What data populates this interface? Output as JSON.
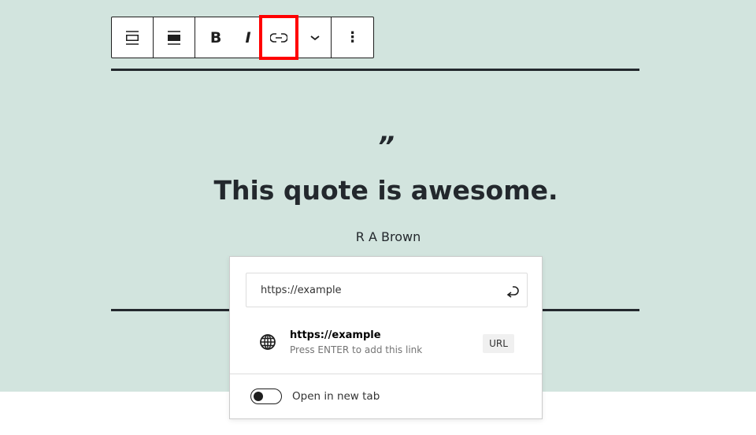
{
  "toolbar": {
    "buttons": [
      "block-type",
      "align",
      "bold",
      "italic",
      "link",
      "more-rich-text",
      "options"
    ],
    "bold_label": "B",
    "italic_label": "I",
    "options_label": "⋮"
  },
  "quote": {
    "mark": "”",
    "text": "This quote is awesome.",
    "citation": "R A Brown"
  },
  "link_popover": {
    "input_value": "https://example",
    "suggestion_title": "https://example",
    "suggestion_hint": "Press ENTER to add this link",
    "suggestion_type": "URL",
    "toggle_label": "Open in new tab",
    "toggle_on": false
  },
  "colors": {
    "background": "#d2e4de",
    "highlight": "#ff0000",
    "text": "#23282d"
  }
}
